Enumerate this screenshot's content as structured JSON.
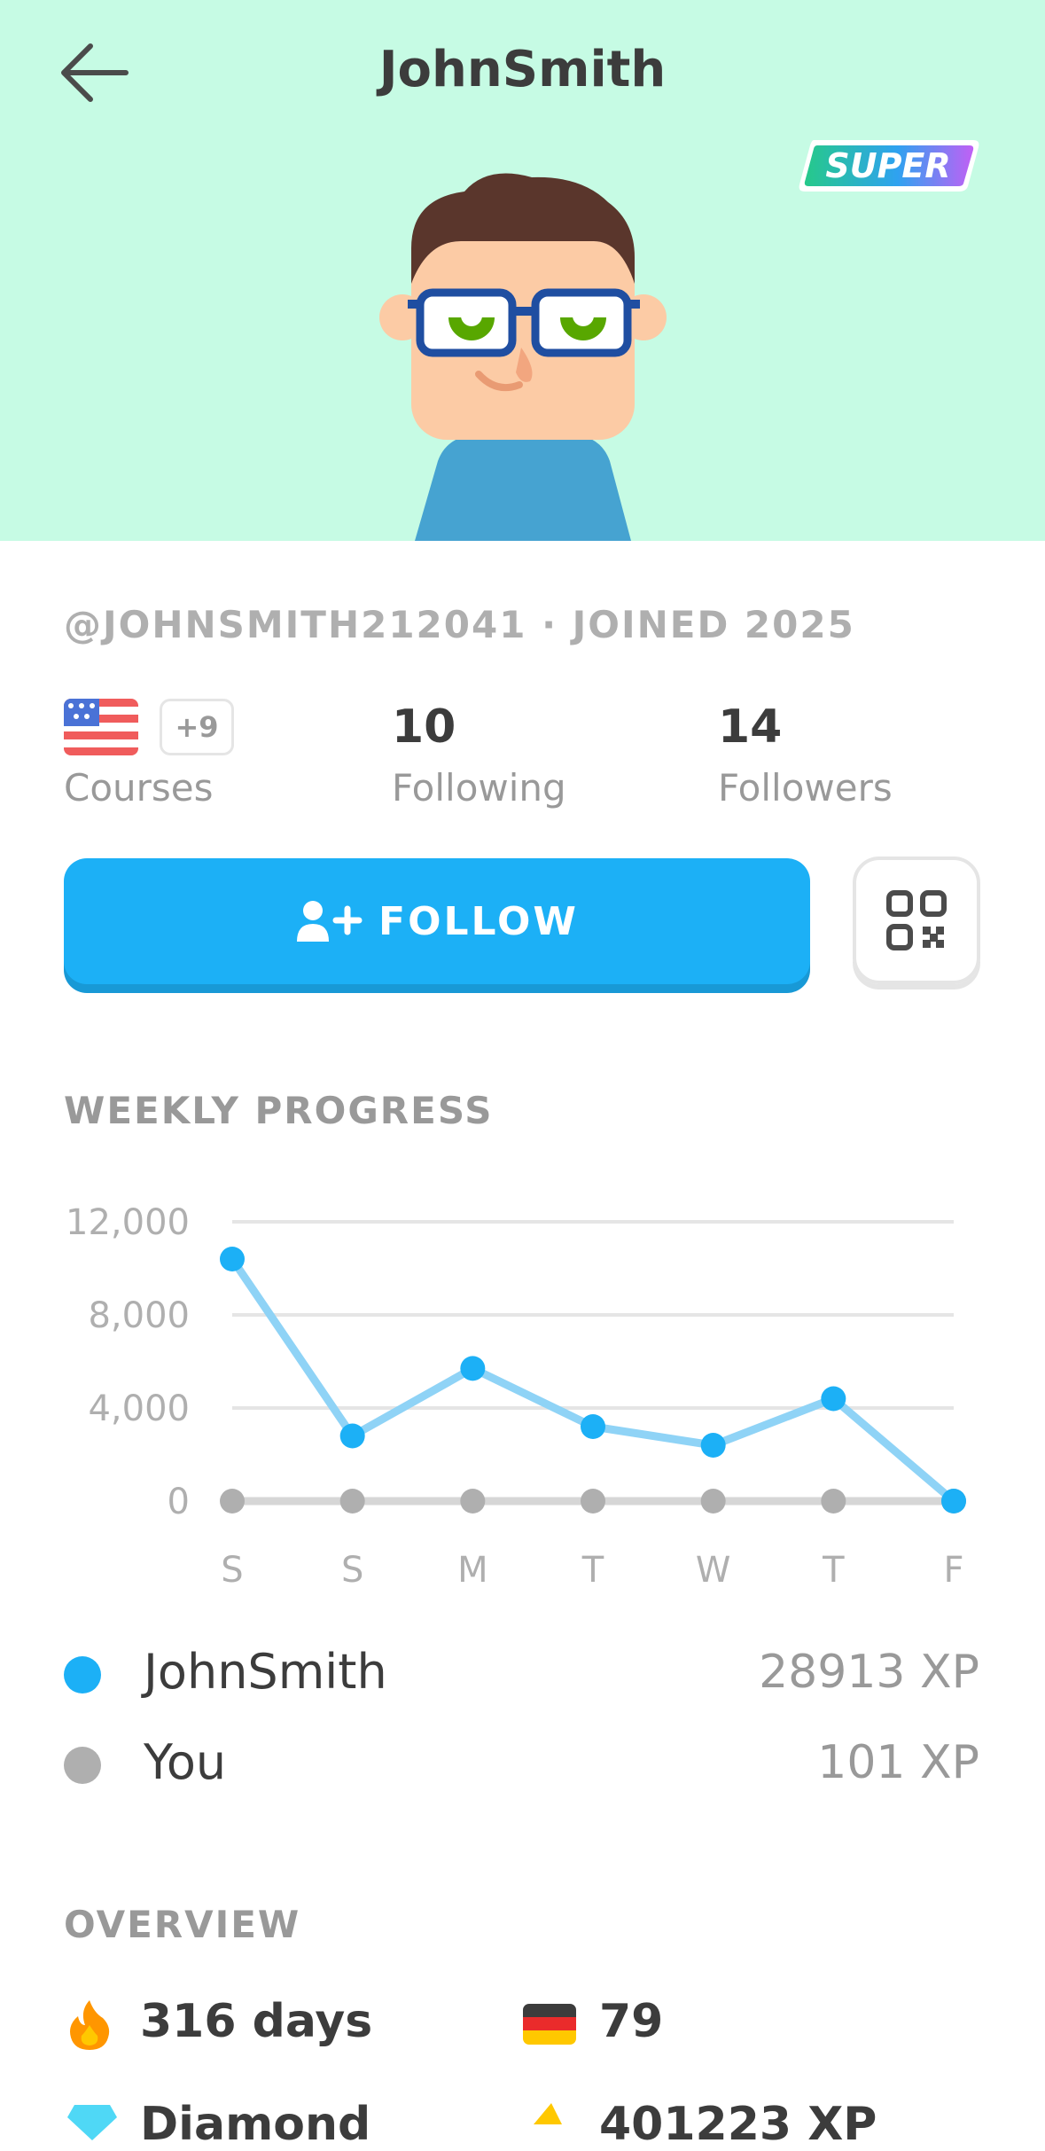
{
  "header": {
    "title": "JohnSmith",
    "badge": "SUPER"
  },
  "profile": {
    "meta": "@JOHNSMITH212041 · JOINED 2025",
    "courses": {
      "extra": "+9",
      "label": "Courses"
    },
    "following": {
      "value": "10",
      "label": "Following"
    },
    "followers": {
      "value": "14",
      "label": "Followers"
    },
    "follow_label": "FOLLOW"
  },
  "weekly": {
    "title": "WEEKLY PROGRESS"
  },
  "chart_data": {
    "type": "line",
    "categories": [
      "S",
      "S",
      "M",
      "T",
      "W",
      "T",
      "F"
    ],
    "series": [
      {
        "name": "JohnSmith",
        "color": "#1cb0f6",
        "values": [
          10400,
          2800,
          5700,
          3200,
          2400,
          4400,
          0
        ]
      },
      {
        "name": "You",
        "color": "#afafaf",
        "values": [
          0,
          0,
          0,
          0,
          0,
          0,
          0
        ]
      }
    ],
    "yticks": [
      "0",
      "4,000",
      "8,000",
      "12,000"
    ],
    "ytick_values": [
      0,
      4000,
      8000,
      12000
    ],
    "ylim": [
      0,
      12000
    ],
    "grid": true
  },
  "legend": [
    {
      "name": "JohnSmith",
      "xp": "28913 XP",
      "color": "#1cb0f6"
    },
    {
      "name": "You",
      "xp": "101 XP",
      "color": "#afafaf"
    }
  ],
  "overview": {
    "title": "OVERVIEW",
    "streak": "316 days",
    "language_score": "79",
    "league": "Diamond",
    "total_xp": "401223 XP"
  }
}
